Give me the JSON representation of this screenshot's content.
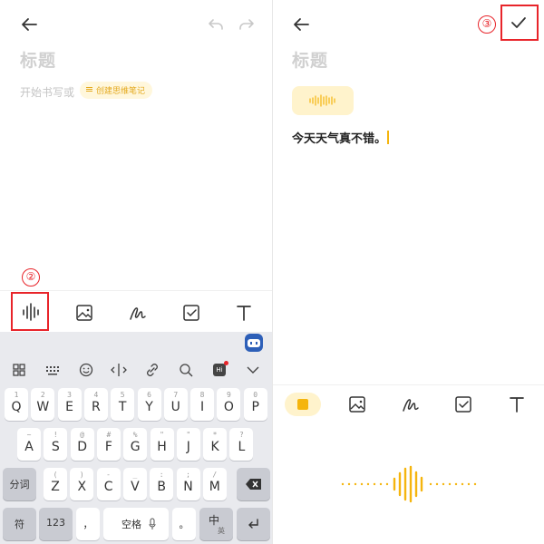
{
  "left": {
    "title_placeholder": "标题",
    "body_placeholder": "开始书写或",
    "mindmap_chip": "创建思维笔记",
    "step_marker": "②",
    "toolbar": [
      "voice-icon",
      "image-icon",
      "handwriting-icon",
      "checkbox-icon",
      "text-format-icon"
    ],
    "keyboard": {
      "row1": [
        {
          "main": "Q",
          "sub": "1"
        },
        {
          "main": "W",
          "sub": "2"
        },
        {
          "main": "E",
          "sub": "3"
        },
        {
          "main": "R",
          "sub": "4"
        },
        {
          "main": "T",
          "sub": "5"
        },
        {
          "main": "Y",
          "sub": "6"
        },
        {
          "main": "U",
          "sub": "7"
        },
        {
          "main": "I",
          "sub": "8"
        },
        {
          "main": "O",
          "sub": "9"
        },
        {
          "main": "P",
          "sub": "0"
        }
      ],
      "row2": [
        {
          "main": "A",
          "sub": "~"
        },
        {
          "main": "S",
          "sub": "!"
        },
        {
          "main": "D",
          "sub": "@"
        },
        {
          "main": "F",
          "sub": "#"
        },
        {
          "main": "G",
          "sub": "%"
        },
        {
          "main": "H",
          "sub": "\""
        },
        {
          "main": "J",
          "sub": "\""
        },
        {
          "main": "K",
          "sub": "*"
        },
        {
          "main": "L",
          "sub": "?"
        }
      ],
      "row3": [
        {
          "main": "Z",
          "sub": "("
        },
        {
          "main": "X",
          "sub": ")"
        },
        {
          "main": "C",
          "sub": "-"
        },
        {
          "main": "V",
          "sub": "_"
        },
        {
          "main": "B",
          "sub": ":"
        },
        {
          "main": "N",
          "sub": ";"
        },
        {
          "main": "M",
          "sub": "/"
        }
      ],
      "fenci": "分词",
      "fu": "符",
      "num": "123",
      "comma": "，",
      "space": "空格",
      "period": "。",
      "zh": "中",
      "zh_sub": "英",
      "hi_badge": "Hi"
    }
  },
  "right": {
    "title_placeholder": "标题",
    "transcript": "今天天气真不错。",
    "step_marker": "③",
    "toolbar": [
      "record-stop-icon",
      "image-icon",
      "handwriting-icon",
      "checkbox-icon",
      "text-format-icon"
    ]
  },
  "colors": {
    "accent": "#f5b50e",
    "accent_light": "#fff3cc",
    "annotation_red": "#e8242a",
    "keyboard_bg": "#e9eaee"
  }
}
